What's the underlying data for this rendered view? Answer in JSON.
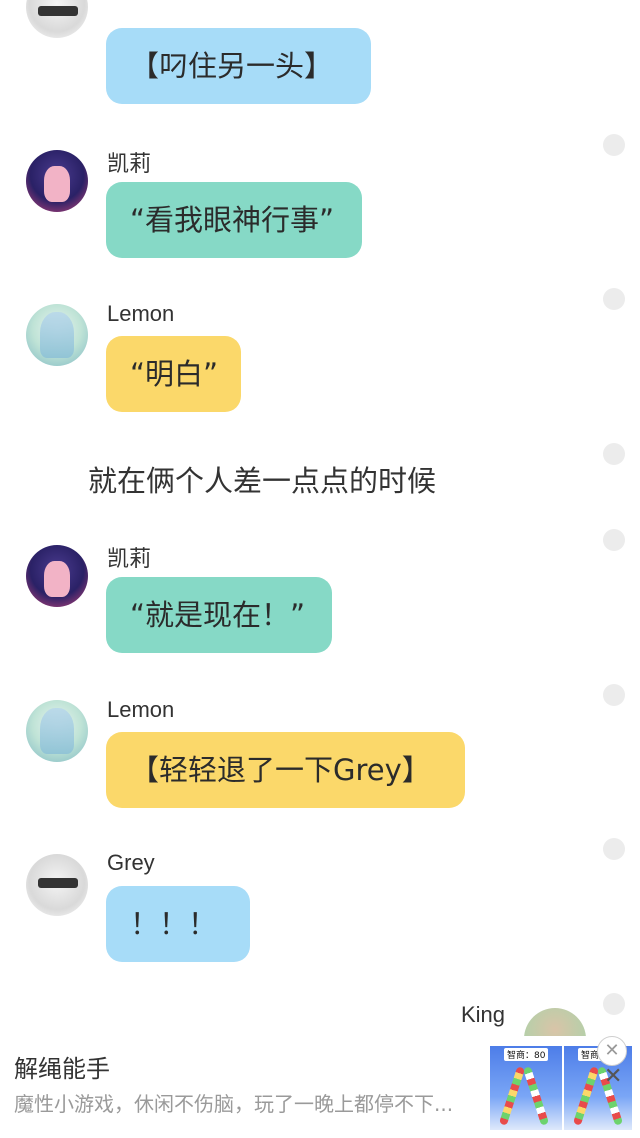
{
  "messages": [
    {
      "text": "【叼住另一头】"
    },
    {
      "name": "凯莉",
      "text": "“看我眼神行事”"
    },
    {
      "name": "Lemon",
      "text": "“明白”"
    },
    {
      "narration": "就在俩个人差一点点的时候"
    },
    {
      "name": "凯莉",
      "text": "“就是现在！”"
    },
    {
      "name": "Lemon",
      "text": "【轻轻退了一下Grey】"
    },
    {
      "name": "Grey",
      "text": "！！！"
    },
    {
      "name": "King"
    }
  ],
  "ad": {
    "title": "解绳能手",
    "description": "魔性小游戏，休闲不伤脑，玩了一晚上都停不下...",
    "score_label_1": "智商：80",
    "score_label_2": "智商",
    "close_icon": "✕"
  },
  "colors": {
    "blue_bubble": "#a7dcf8",
    "teal_bubble": "#86d9c6",
    "yellow_bubble": "#fbd86a"
  }
}
